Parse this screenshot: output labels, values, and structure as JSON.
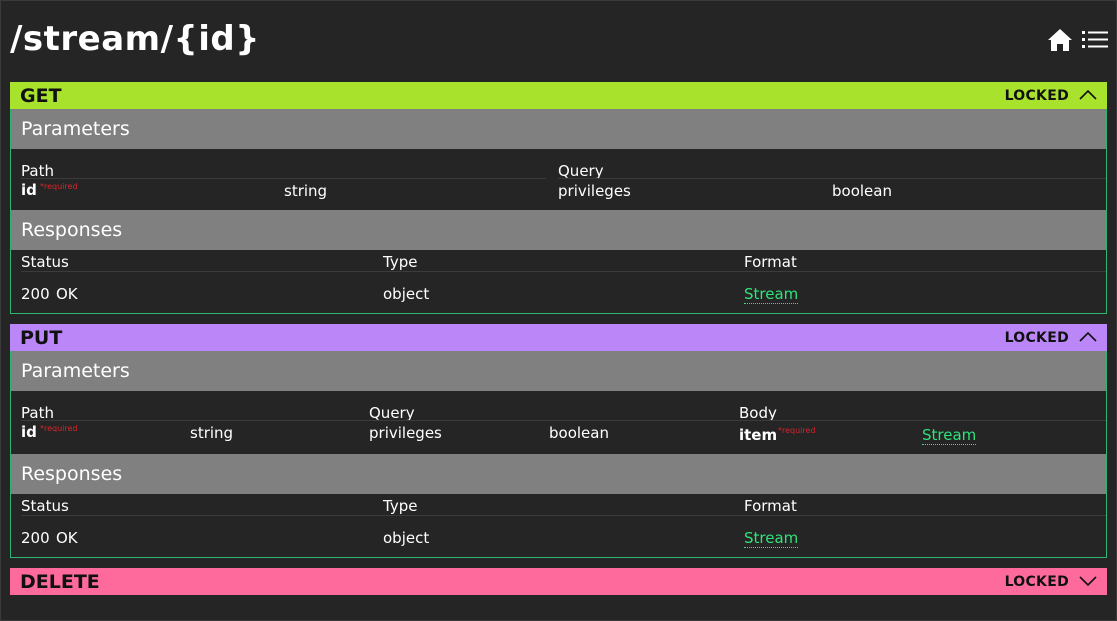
{
  "page": {
    "title": "/stream/{id}"
  },
  "nav": {
    "home_icon": "home-icon",
    "menu_icon": "list-menu-icon"
  },
  "colors": {
    "get": "#a9e22d",
    "put": "#bb86f8",
    "delete": "#fe6a9c",
    "border": "#2fb572",
    "link": "#2ee37a",
    "required": "#d9242b"
  },
  "operations": [
    {
      "method": "GET",
      "locked": "LOCKED",
      "expanded": true,
      "parameters_title": "Parameters",
      "groups": [
        {
          "title": "Path",
          "params": [
            {
              "name": "id",
              "required": "*required",
              "type": "string"
            }
          ]
        },
        {
          "title": "Query",
          "params": [
            {
              "name": "privileges",
              "type": "boolean"
            }
          ]
        }
      ],
      "responses_title": "Responses",
      "response_headers": [
        "Status",
        "Type",
        "Format"
      ],
      "responses": [
        {
          "status": "200",
          "text": "OK",
          "type": "object",
          "format": "Stream"
        }
      ]
    },
    {
      "method": "PUT",
      "locked": "LOCKED",
      "expanded": true,
      "parameters_title": "Parameters",
      "groups": [
        {
          "title": "Path",
          "params": [
            {
              "name": "id",
              "required": "*required",
              "type": "string"
            }
          ]
        },
        {
          "title": "Query",
          "params": [
            {
              "name": "privileges",
              "type": "boolean"
            }
          ]
        },
        {
          "title": "Body",
          "params": [
            {
              "name": "item",
              "required": "*required",
              "type": "Stream"
            }
          ]
        }
      ],
      "responses_title": "Responses",
      "response_headers": [
        "Status",
        "Type",
        "Format"
      ],
      "responses": [
        {
          "status": "200",
          "text": "OK",
          "type": "object",
          "format": "Stream"
        }
      ]
    },
    {
      "method": "DELETE",
      "locked": "LOCKED",
      "expanded": false
    }
  ]
}
